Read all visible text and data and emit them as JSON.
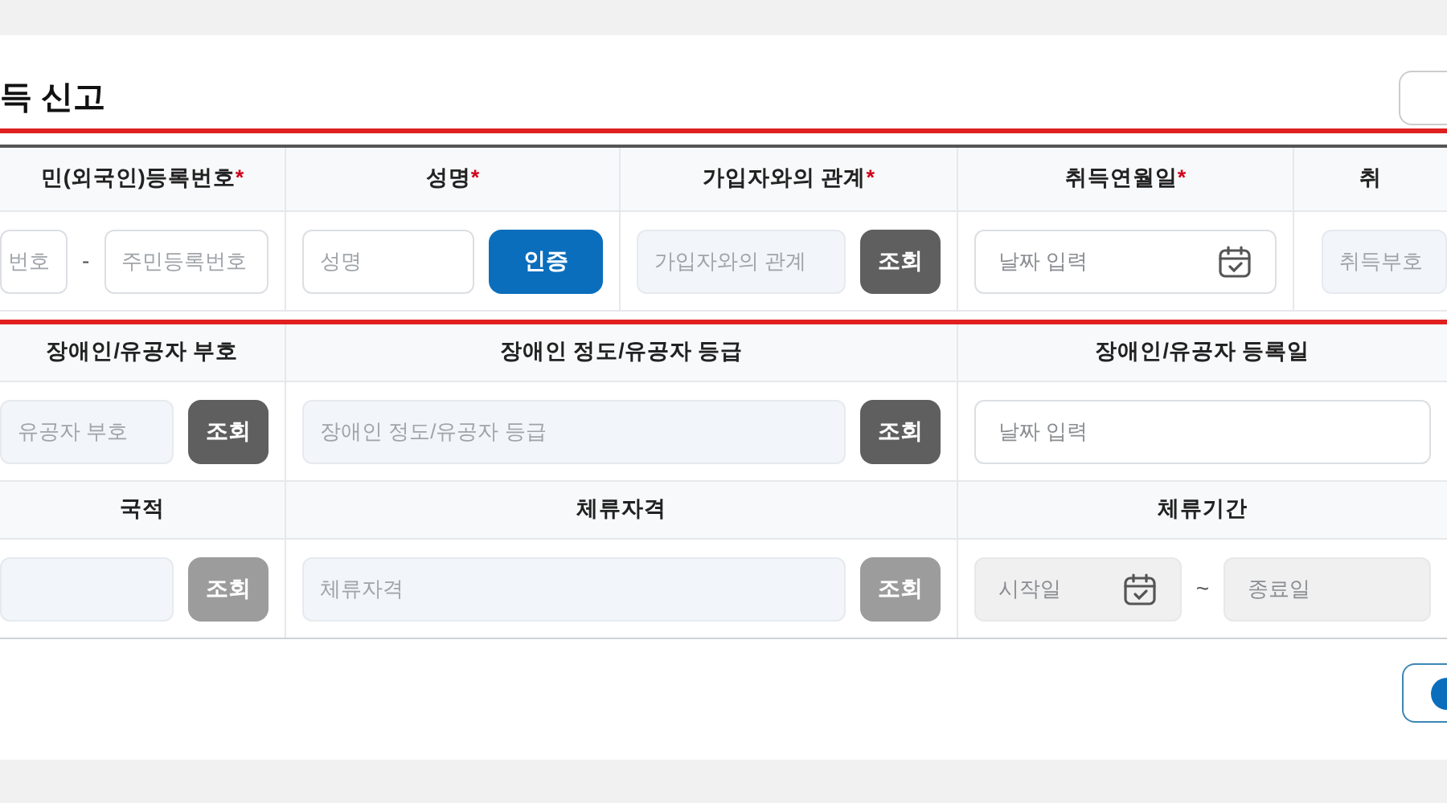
{
  "title": "득 신고",
  "row_groups": [
    {
      "cells": [
        {
          "header": "민(외국인)등록번호",
          "required_mark": "*",
          "fields": [
            {
              "kind": "text",
              "placeholder": "번호",
              "readonly": false
            },
            {
              "kind": "sep",
              "text": "-"
            },
            {
              "kind": "text",
              "placeholder": "주민등록번호",
              "readonly": false
            }
          ]
        },
        {
          "header": "성명",
          "required_mark": "*",
          "fields": [
            {
              "kind": "text",
              "placeholder": "성명",
              "readonly": false
            },
            {
              "kind": "verify_button",
              "label": "인증"
            }
          ]
        },
        {
          "header": "가입자와의 관계",
          "required_mark": "*",
          "fields": [
            {
              "kind": "text",
              "placeholder": "가입자와의 관계",
              "readonly": true
            },
            {
              "kind": "lookup_button",
              "label": "조회",
              "disabled": false
            }
          ]
        },
        {
          "header": "취득연월일",
          "required_mark": "*",
          "fields": [
            {
              "kind": "date",
              "placeholder": "날짜 입력",
              "disabled": false,
              "icon": true
            }
          ]
        },
        {
          "header": "취",
          "fields": [
            {
              "kind": "text",
              "placeholder": "취득부호",
              "readonly": true
            }
          ]
        }
      ]
    },
    {
      "cells": [
        {
          "header": "장애인/유공자 부호",
          "fields": [
            {
              "kind": "text",
              "placeholder": "유공자 부호",
              "readonly": true
            },
            {
              "kind": "lookup_button",
              "label": "조회",
              "disabled": false
            }
          ]
        },
        {
          "header": "장애인 정도/유공자 등급",
          "fields": [
            {
              "kind": "text",
              "placeholder": "장애인 정도/유공자 등급",
              "readonly": true
            },
            {
              "kind": "lookup_button",
              "label": "조회",
              "disabled": false
            }
          ]
        },
        {
          "header": "장애인/유공자 등록일",
          "fields": [
            {
              "kind": "date",
              "placeholder": "날짜 입력",
              "disabled": false,
              "icon": false
            }
          ]
        }
      ]
    },
    {
      "cells": [
        {
          "header": "국적",
          "fields": [
            {
              "kind": "text",
              "readonly": true
            },
            {
              "kind": "lookup_button",
              "label": "조회",
              "disabled": true
            }
          ]
        },
        {
          "header": "체류자격",
          "fields": [
            {
              "kind": "text",
              "placeholder": "체류자격",
              "readonly": true
            },
            {
              "kind": "lookup_button",
              "label": "조회",
              "disabled": true
            }
          ]
        },
        {
          "header": "체류기간",
          "fields": [
            {
              "kind": "date",
              "placeholder": "시작일",
              "disabled": true,
              "icon": true
            },
            {
              "kind": "sep",
              "text": "~"
            },
            {
              "kind": "date",
              "placeholder": "종료일",
              "disabled": true,
              "icon": false
            }
          ]
        }
      ]
    }
  ]
}
